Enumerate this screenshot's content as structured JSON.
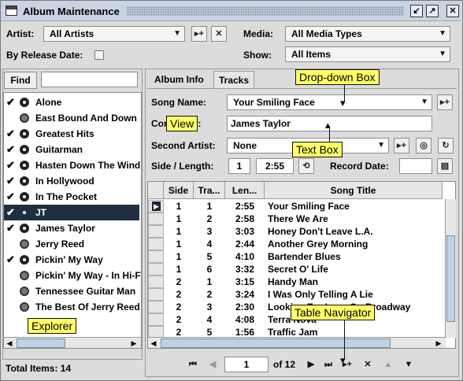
{
  "window": {
    "title": "Album Maintenance"
  },
  "filters": {
    "artist_label": "Artist:",
    "artist_value": "All Artists",
    "media_label": "Media:",
    "media_value": "All Media Types",
    "release_label": "By Release Date:",
    "show_label": "Show:",
    "show_value": "All Items"
  },
  "explorer": {
    "find_label": "Find",
    "items": [
      {
        "label": "Alone",
        "checked": true,
        "icon": "disc-icon"
      },
      {
        "label": "East Bound And Down",
        "checked": false,
        "icon": "multi-disc-icon"
      },
      {
        "label": "Greatest Hits",
        "checked": true,
        "icon": "disc-icon"
      },
      {
        "label": "Guitarman",
        "checked": true,
        "icon": "disc-icon"
      },
      {
        "label": "Hasten Down The Wind",
        "checked": true,
        "icon": "disc-icon"
      },
      {
        "label": "In Hollywood",
        "checked": true,
        "icon": "disc-icon"
      },
      {
        "label": "In The Pocket",
        "checked": true,
        "icon": "disc-icon"
      },
      {
        "label": "JT",
        "checked": true,
        "icon": "disc-icon",
        "selected": true
      },
      {
        "label": "James Taylor",
        "checked": true,
        "icon": "disc-icon"
      },
      {
        "label": "Jerry Reed",
        "checked": false,
        "icon": "multi-disc-icon"
      },
      {
        "label": "Pickin' My Way",
        "checked": true,
        "icon": "disc-icon"
      },
      {
        "label": "Pickin' My Way - In Hi-Fi",
        "checked": false,
        "icon": "multi-disc-icon"
      },
      {
        "label": "Tennessee Guitar Man",
        "checked": false,
        "icon": "multi-disc-icon"
      },
      {
        "label": "The Best Of Jerry Reed",
        "checked": false,
        "icon": "multi-disc-icon"
      }
    ],
    "total_items": "Total Items: 14"
  },
  "tabs": [
    "Album Info",
    "Tracks"
  ],
  "track_form": {
    "song_name_label": "Song Name:",
    "song_name_value": "Your Smiling Face",
    "composer_label": "Composer:",
    "composer_value": "James Taylor",
    "second_artist_label": "Second Artist:",
    "second_artist_value": "None",
    "side_length_label": "Side / Length:",
    "side_value": "1",
    "length_value": "2:55",
    "record_date_label": "Record Date:"
  },
  "grid": {
    "columns": [
      "Side",
      "Tra...",
      "Len...",
      "Song Title"
    ],
    "rows": [
      [
        "1",
        "1",
        "2:55",
        "Your Smiling Face"
      ],
      [
        "1",
        "2",
        "2:58",
        "There We Are"
      ],
      [
        "1",
        "3",
        "3:03",
        "Honey Don't Leave L.A."
      ],
      [
        "1",
        "4",
        "2:44",
        "Another Grey Morning"
      ],
      [
        "1",
        "5",
        "4:10",
        "Bartender Blues"
      ],
      [
        "1",
        "6",
        "3:32",
        "Secret O' Life"
      ],
      [
        "2",
        "1",
        "3:15",
        "Handy Man"
      ],
      [
        "2",
        "2",
        "3:24",
        "I Was Only Telling A Lie"
      ],
      [
        "2",
        "3",
        "2:30",
        "Looking For Love On Broadway"
      ],
      [
        "2",
        "4",
        "4:08",
        "Terra Nova"
      ],
      [
        "2",
        "5",
        "1:56",
        "Traffic Jam"
      ]
    ]
  },
  "navigator": {
    "page_value": "1",
    "page_total": "of 12"
  },
  "annotations": {
    "dropdown": "Drop-down Box",
    "view": "View",
    "textbox": "Text Box",
    "explorer": "Explorer",
    "navigator": "Table Navigator"
  }
}
